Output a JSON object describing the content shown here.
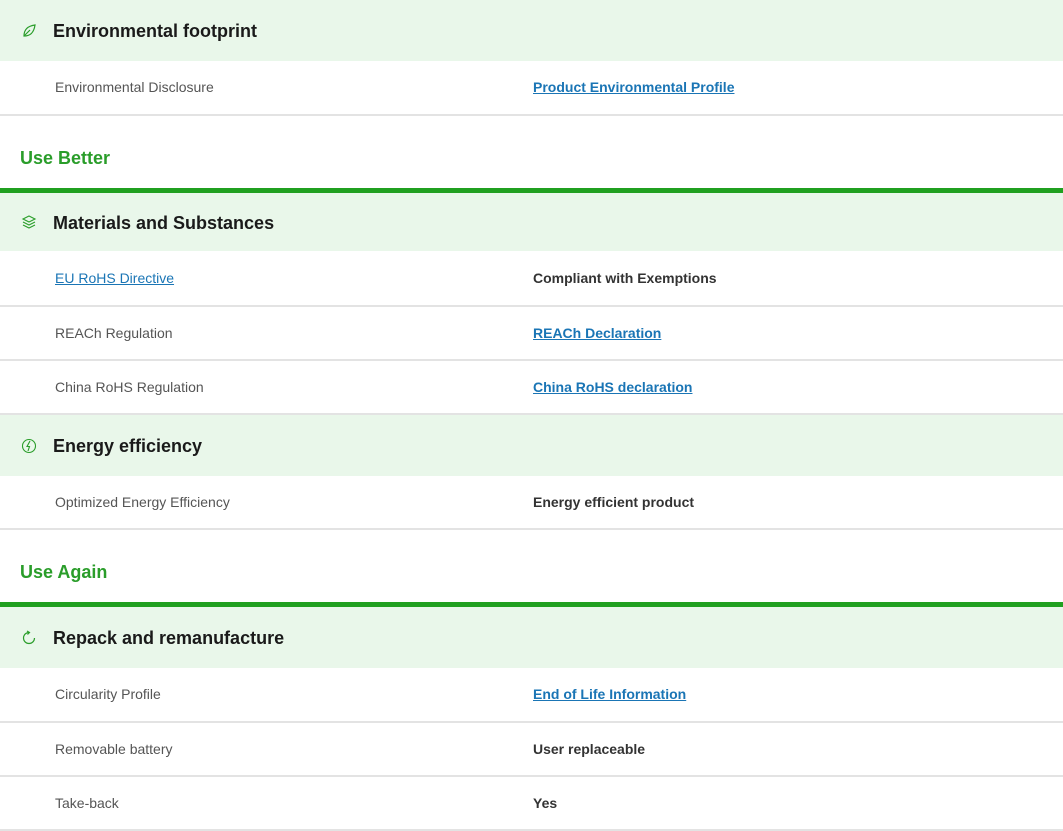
{
  "groups": {
    "environmental_footprint": {
      "title": "Environmental footprint",
      "icon": "leaf-icon",
      "rows": [
        {
          "label": "Environmental Disclosure",
          "value": "Product Environmental Profile"
        }
      ]
    },
    "materials": {
      "title": "Materials and Substances",
      "icon": "layers-icon",
      "rows": [
        {
          "label": "EU RoHS Directive",
          "value": "Compliant with Exemptions"
        },
        {
          "label": "REACh Regulation",
          "value": "REACh Declaration"
        },
        {
          "label": "China RoHS Regulation",
          "value": "China RoHS declaration"
        }
      ]
    },
    "energy": {
      "title": "Energy efficiency",
      "icon": "energy-leaf-icon",
      "rows": [
        {
          "label": "Optimized Energy Efficiency",
          "value": "Energy efficient product"
        }
      ]
    },
    "repack": {
      "title": "Repack and remanufacture",
      "icon": "refresh-icon",
      "rows": [
        {
          "label": "Circularity Profile",
          "value": "End of Life Information"
        },
        {
          "label": "Removable battery",
          "value": "User replaceable"
        },
        {
          "label": "Take-back",
          "value": "Yes"
        }
      ]
    }
  },
  "sections": {
    "use_better": "Use Better",
    "use_again": "Use Again"
  },
  "colors": {
    "accent_green": "#2a9d2a",
    "header_bg": "#e9f7ea",
    "link_blue": "#1a75b5"
  }
}
